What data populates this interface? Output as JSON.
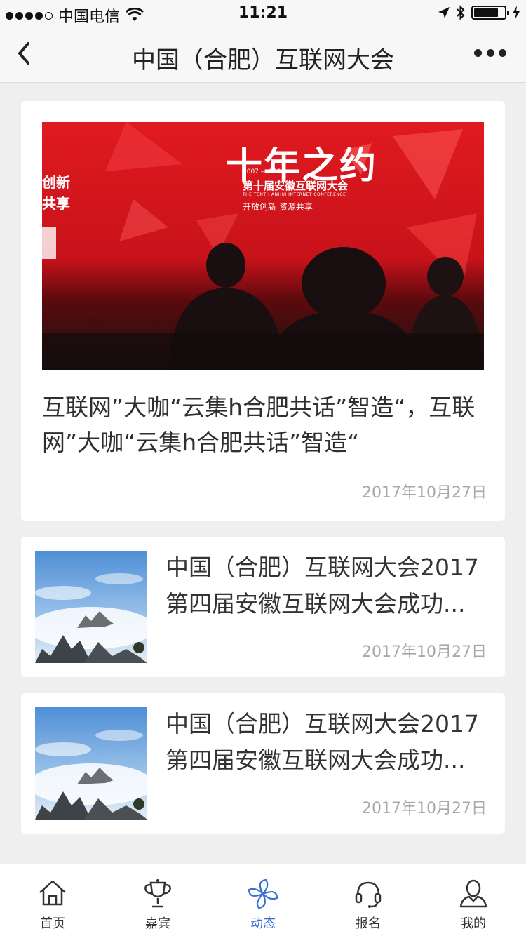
{
  "status_bar": {
    "carrier": "中国电信",
    "time": "11:21"
  },
  "nav": {
    "title": "中国（合肥）互联网大会",
    "back_icon": "chevron-left-icon",
    "more_icon": "more-dots-icon"
  },
  "featured": {
    "title": "互联网”大咖“云集h合肥共话”智造“，互联网”大咖“云集h合肥共话”智造“",
    "date": "2017年10月27日",
    "image": {
      "headline": "十年之约",
      "years": "2007 — 2016",
      "conference": "第十届安徽互联网大会",
      "conference_en": "THE TENTH ANHUI INTERNET CONFERENCE",
      "slogan": "开放创新 资源共享",
      "side_text_1": "创新",
      "side_text_2": "共享",
      "brand_color": "#d8161c"
    }
  },
  "list": [
    {
      "title_line1": "中国（合肥）互联网大会2017",
      "title_line2": "第四届安徽互联网大会成功...",
      "date": "2017年10月27日"
    },
    {
      "title_line1": "中国（合肥）互联网大会2017",
      "title_line2": "第四届安徽互联网大会成功...",
      "date": "2017年10月27日"
    }
  ],
  "tabs": [
    {
      "label": "首页",
      "icon": "home-icon",
      "active": false
    },
    {
      "label": "嘉宾",
      "icon": "trophy-icon",
      "active": false
    },
    {
      "label": "动态",
      "icon": "pinwheel-icon",
      "active": true
    },
    {
      "label": "报名",
      "icon": "headset-icon",
      "active": false
    },
    {
      "label": "我的",
      "icon": "user-icon",
      "active": false
    }
  ],
  "colors": {
    "accent": "#3a6fd8",
    "text": "#333333",
    "date": "#a8a8a8",
    "background": "#efefef"
  }
}
